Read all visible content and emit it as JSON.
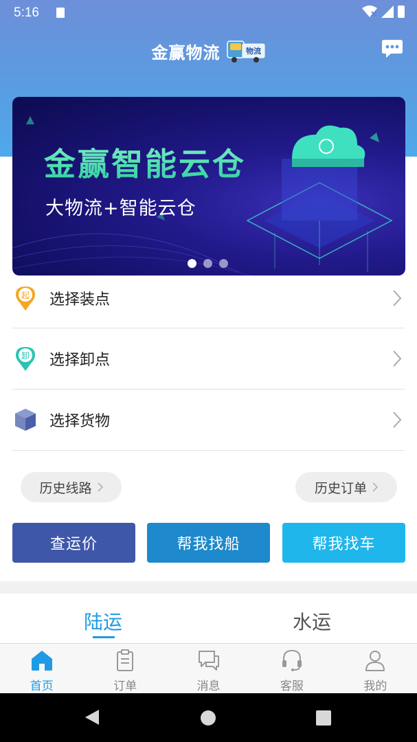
{
  "status_bar": {
    "time": "5:16"
  },
  "header": {
    "title": "金赢物流",
    "logo_text": "物流"
  },
  "banner": {
    "title": "金赢智能云仓",
    "subtitle": "大物流+智能云仓",
    "dots": 3,
    "active_dot": 0
  },
  "menu": [
    {
      "label": "选择装点",
      "icon_char": "起",
      "icon_color": "#f5a623"
    },
    {
      "label": "选择卸点",
      "icon_char": "卸",
      "icon_color": "#2ac3b5"
    },
    {
      "label": "选择货物",
      "icon_char": "",
      "icon_color": "#4a5fa8"
    }
  ],
  "history": {
    "routes": "历史线路",
    "orders": "历史订单"
  },
  "actions": {
    "price": "查运价",
    "ship": "帮我找船",
    "car": "帮我找车"
  },
  "colors": {
    "accent": "#1e9be6",
    "btn_price": "#3e57a9",
    "btn_ship": "#1e89cc",
    "btn_car": "#1fb6ec"
  },
  "mode_tabs": {
    "land": "陆运",
    "water": "水运",
    "selected": "land"
  },
  "bottom_nav": [
    {
      "label": "首页",
      "icon": "home-icon",
      "active": true
    },
    {
      "label": "订单",
      "icon": "clipboard-icon",
      "active": false
    },
    {
      "label": "消息",
      "icon": "chat-bubbles-icon",
      "active": false
    },
    {
      "label": "客服",
      "icon": "headset-icon",
      "active": false
    },
    {
      "label": "我的",
      "icon": "user-icon",
      "active": false
    }
  ]
}
